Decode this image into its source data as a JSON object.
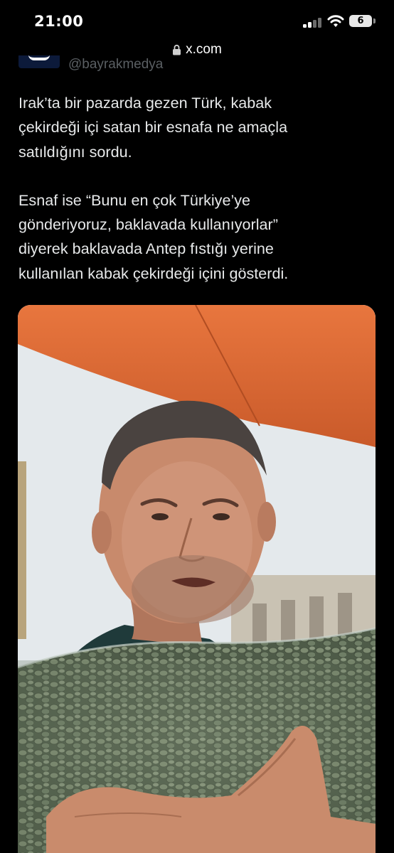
{
  "status_bar": {
    "time": "21:00",
    "battery_level": "6",
    "icons": [
      "cellular-signal-icon",
      "wifi-icon",
      "battery-icon"
    ]
  },
  "browser": {
    "url": "x.com",
    "lock_icon": "lock-icon"
  },
  "tweet": {
    "author_handle": "@bayrakmedya",
    "paragraphs": [
      "Irak’ta bir pazarda gezen Türk, kabak\nçekirdeği içi satan bir esnafa ne amaçla\nsatıldığını sordu.",
      "Esnaf ise “Bunu en çok Türkiye’ye\ngönderiyoruz, baklavada kullanıyorlar”\ndiyerek baklavada Antep fıstığı yerine\nkullanılan kabak çekirdeği içini gösterdi."
    ],
    "media": {
      "kind": "video-still",
      "colors": {
        "awning": "#e2703a",
        "seeds": "#74836a",
        "sky": "#e4e9ec"
      }
    }
  },
  "theme": {
    "background": "#000000",
    "text": "#e7e9ea",
    "muted": "#5a5f63"
  }
}
